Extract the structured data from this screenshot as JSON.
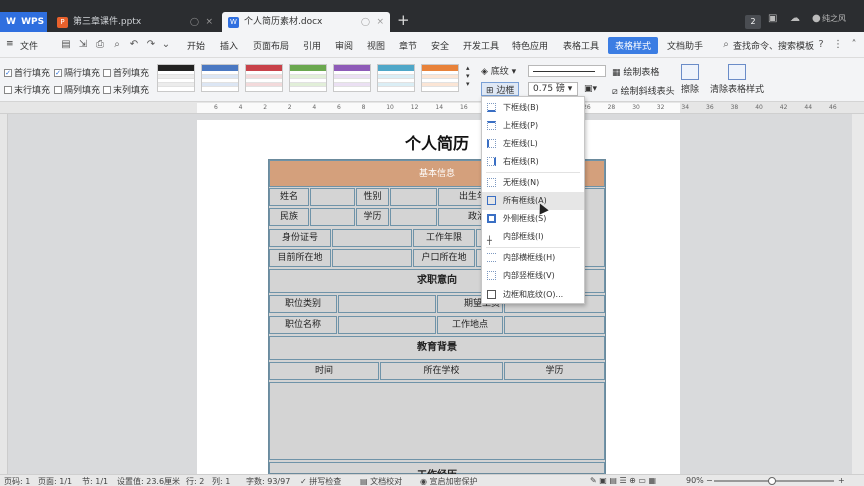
{
  "titlebar": {
    "app_label": "WPS",
    "tabs": [
      {
        "label": "第三章课件.pptx",
        "icon": "pptx-icon",
        "color": "#e8612c"
      },
      {
        "label": "个人简历素材.docx",
        "icon": "docx-icon",
        "color": "#2f6fdf"
      }
    ],
    "badge": "2",
    "user": "纯之风"
  },
  "menubar": {
    "file": "文件",
    "items": [
      "开始",
      "插入",
      "页面布局",
      "引用",
      "审阅",
      "视图",
      "章节",
      "安全",
      "开发工具",
      "特色应用",
      "表格工具",
      "表格样式",
      "文档助手"
    ],
    "active": "表格样式",
    "search": "查找命令、搜索模板"
  },
  "ribbon": {
    "checks": [
      {
        "label": "首行填充",
        "checked": true
      },
      {
        "label": "隔行填充",
        "checked": true
      },
      {
        "label": "首列填充",
        "checked": false
      },
      {
        "label": "末行填充",
        "checked": false
      },
      {
        "label": "隔列填充",
        "checked": false
      },
      {
        "label": "末列填充",
        "checked": false
      }
    ],
    "style_colors": [
      "#222222",
      "#4a78c2",
      "#c8424a",
      "#6aa84f",
      "#8e5bb8",
      "#4fa7c8",
      "#e8823a"
    ],
    "shading_label": "底纹",
    "border_label": "边框",
    "line_width": "0.75",
    "line_unit": "磅",
    "draw_table": "绘制表格",
    "draw_diag": "绘制斜线表头",
    "erase": "擦除",
    "clear_style": "清除表格样式"
  },
  "ruler": {
    "numbers": [
      "6",
      "4",
      "2",
      "2",
      "4",
      "6",
      "8",
      "10",
      "12",
      "14",
      "16",
      "18",
      "20",
      "22",
      "24",
      "26",
      "28",
      "30",
      "32",
      "34",
      "36",
      "38",
      "40",
      "42",
      "44",
      "46"
    ]
  },
  "document": {
    "title": "个人简历",
    "section_basic": "基本信息",
    "rows": {
      "name": "姓名",
      "gender": "性别",
      "birth": "出生年月",
      "ethnicity": "民族",
      "education": "学历",
      "political": "政治面",
      "id": "身份证号",
      "work_years": "工作年限",
      "location": "目前所在地",
      "hukou": "户口所在地"
    },
    "section_job": "求职意向",
    "job": {
      "type": "职位类别",
      "salary": "期望工资",
      "name": "职位名称",
      "place": "工作地点"
    },
    "section_edu": "教育背景",
    "edu": {
      "time": "时间",
      "school": "所在学校",
      "degree": "学历"
    },
    "section_work": "工作经历"
  },
  "dropdown": {
    "items": [
      {
        "label": "下框线(B)"
      },
      {
        "label": "上框线(P)"
      },
      {
        "label": "左框线(L)"
      },
      {
        "label": "右框线(R)"
      },
      {
        "label": "无框线(N)"
      },
      {
        "label": "所有框线(A)",
        "hover": true
      },
      {
        "label": "外侧框线(S)"
      },
      {
        "label": "内部框线(I)"
      },
      {
        "label": "内部横框线(H)"
      },
      {
        "label": "内部竖框线(V)"
      },
      {
        "label": "边框和底纹(O)..."
      }
    ]
  },
  "statusbar": {
    "page": "页码: 1",
    "pages": "页面: 1/1",
    "section": "节: 1/1",
    "setting": "设置值: 23.6厘米",
    "row": "行: 2",
    "col": "列: 1",
    "words": "字数: 93/97",
    "spell": "拼写检查",
    "proof": "文档校对",
    "protect": "宣启加密保护",
    "zoom": "90%",
    "zoom_level": 0.48
  }
}
